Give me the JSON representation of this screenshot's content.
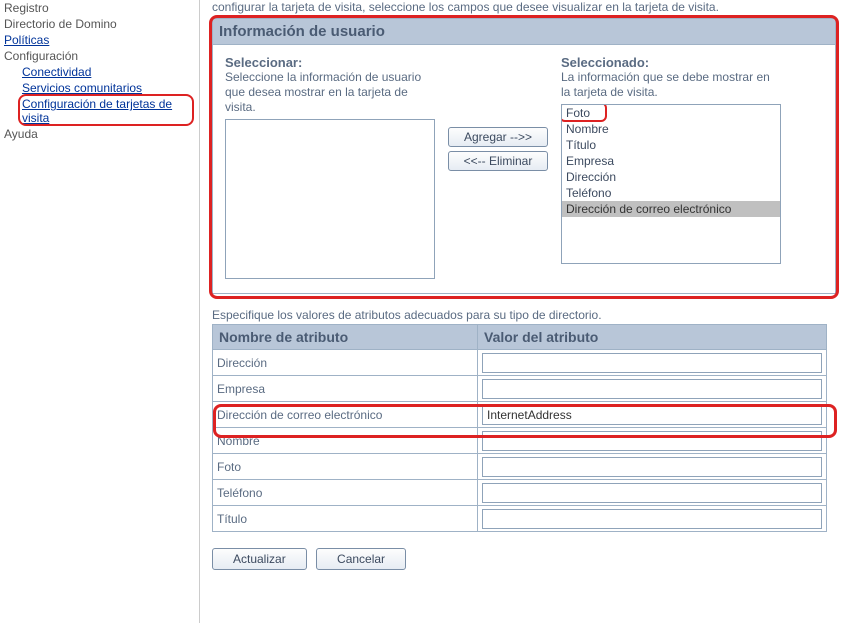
{
  "sidebar": {
    "items": [
      {
        "label": "Registro",
        "link": false
      },
      {
        "label": "Directorio de Domino",
        "link": false
      },
      {
        "label": "Políticas",
        "link": true
      },
      {
        "label": "Configuración",
        "link": false
      },
      {
        "label": "Conectividad",
        "link": true,
        "indent": true
      },
      {
        "label": "Servicios comunitarios",
        "link": true,
        "indent": true,
        "strike": true
      },
      {
        "label": "Configuración de tarjetas de visita",
        "link": true,
        "indent": true,
        "highlight": true
      },
      {
        "label": "Ayuda",
        "link": false
      }
    ]
  },
  "intro": "configurar la tarjeta de visita, seleccione los campos que desee visualizar en la tarjeta de visita.",
  "panel": {
    "title": "Información de usuario",
    "left": {
      "heading": "Seleccionar:",
      "desc": "Seleccione la información de usuario que desea mostrar en la tarjeta de visita."
    },
    "right": {
      "heading": "Seleccionado:",
      "desc": "La información que se debe mostrar en la tarjeta de visita.",
      "items": [
        "Foto",
        "Nombre",
        "Título",
        "Empresa",
        "Dirección",
        "Teléfono",
        "Dirección de correo electrónico"
      ],
      "selected_index": 6
    },
    "buttons": {
      "add": "Agregar -->>",
      "remove": "<<-- Eliminar"
    }
  },
  "spec_label": "Especifique los valores de atributos adecuados para su tipo de directorio.",
  "attr_table": {
    "headers": {
      "name": "Nombre de atributo",
      "value": "Valor del atributo"
    },
    "rows": [
      {
        "name": "Dirección",
        "value": ""
      },
      {
        "name": "Empresa",
        "value": ""
      },
      {
        "name": "Dirección de correo electrónico",
        "value": "InternetAddress",
        "highlight": true
      },
      {
        "name": "Nombre",
        "value": ""
      },
      {
        "name": "Foto",
        "value": ""
      },
      {
        "name": "Teléfono",
        "value": ""
      },
      {
        "name": "Título",
        "value": ""
      }
    ]
  },
  "footer": {
    "update": "Actualizar",
    "cancel": "Cancelar"
  }
}
